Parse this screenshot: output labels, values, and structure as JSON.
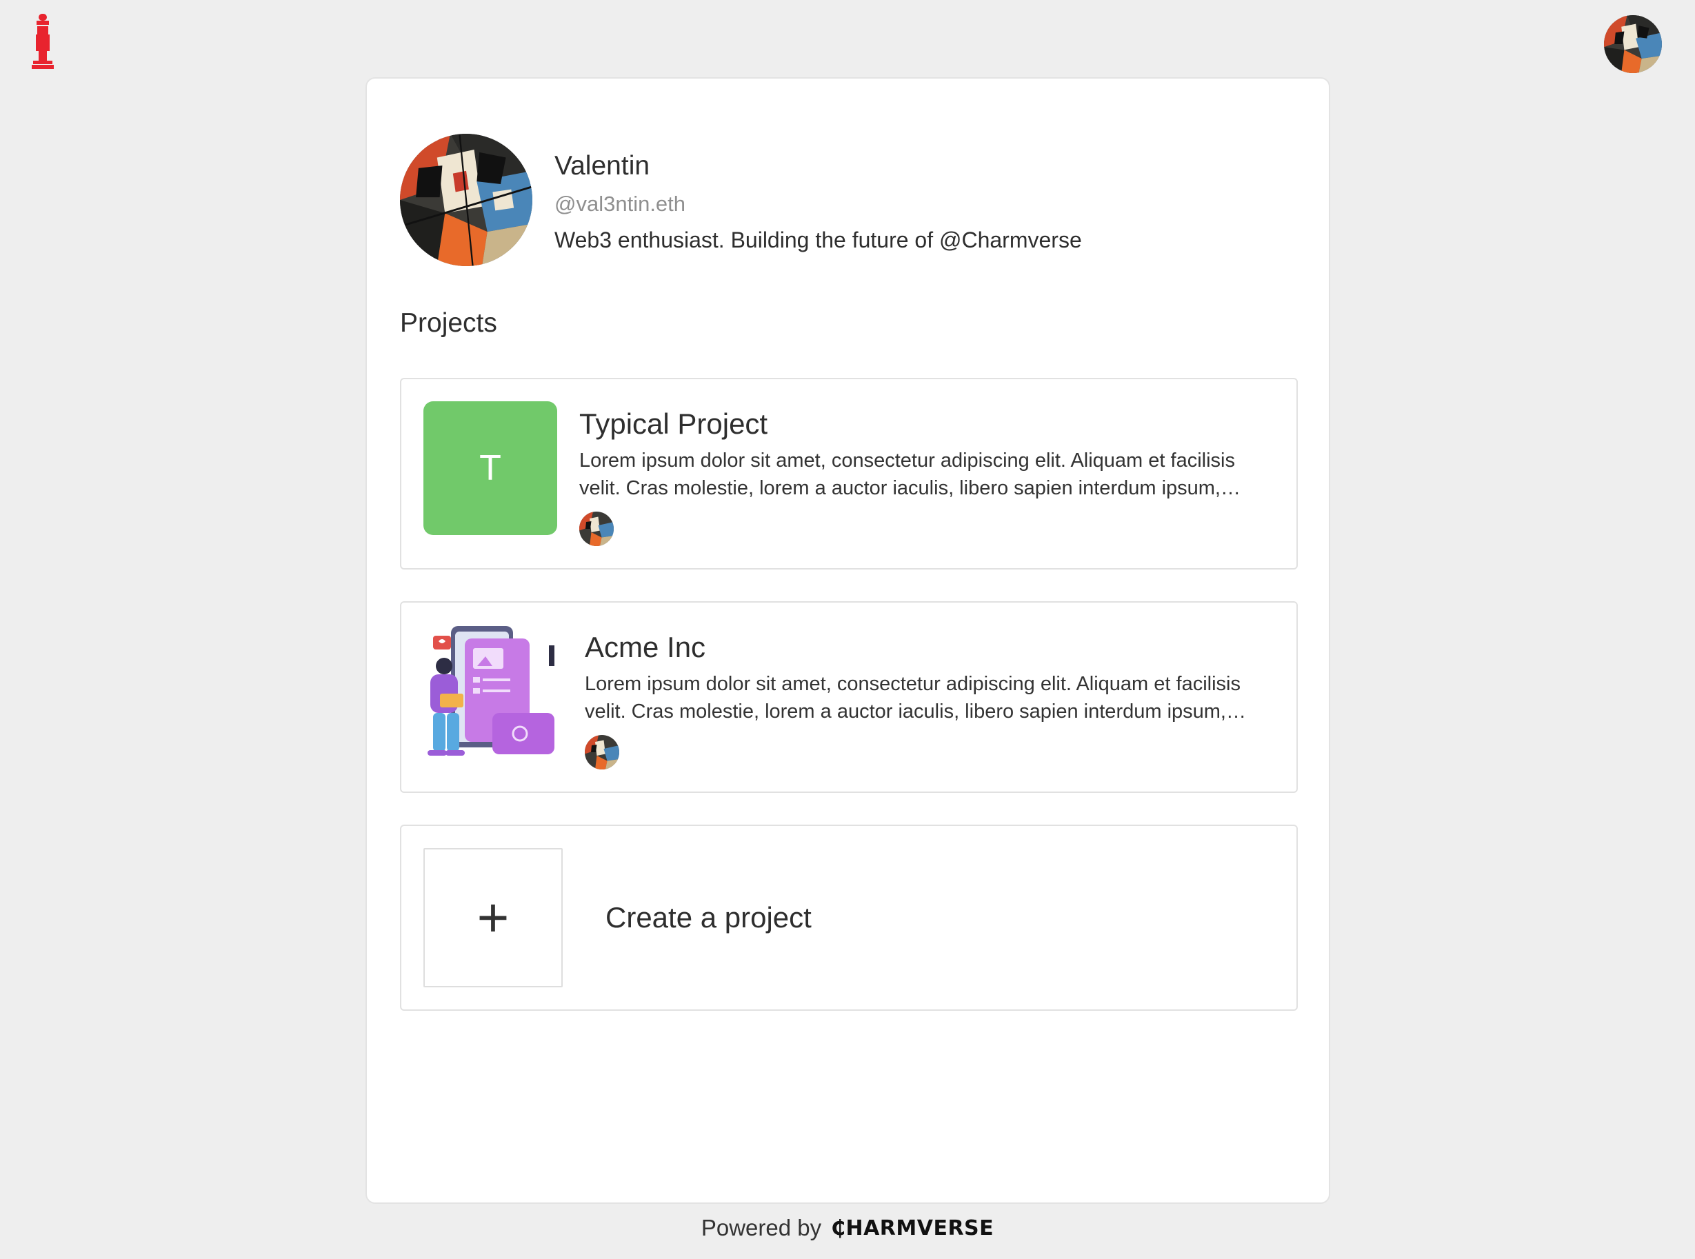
{
  "header": {
    "logo_icon": "red-figure-logo-icon",
    "user_avatar_icon": "cubist-portrait-avatar-icon"
  },
  "profile": {
    "name": "Valentin",
    "handle": "@val3ntin.eth",
    "bio": "Web3 enthusiast. Building the future of @Charmverse"
  },
  "projects_section": {
    "title": "Projects",
    "items": [
      {
        "thumbnail_letter": "T",
        "title": "Typical Project",
        "description": "Lorem ipsum dolor sit amet, consectetur adipiscing elit. Aliquam et facilisis velit. Cras molestie, lorem a auctor iaculis, libero sapien interdum ipsum, mattis vehicula nunc",
        "thumbnail_color": "#71c96a"
      },
      {
        "title": "Acme Inc",
        "description": "Lorem ipsum dolor sit amet, consectetur adipiscing elit. Aliquam et facilisis velit. Cras molestie, lorem a auctor iaculis, libero sapien interdum ipsum, mattis vehicula nunc"
      }
    ],
    "create": {
      "plus": "+",
      "label": "Create a project"
    }
  },
  "footer": {
    "powered_by": "Powered by",
    "brand": "₵HARMVERSE"
  }
}
